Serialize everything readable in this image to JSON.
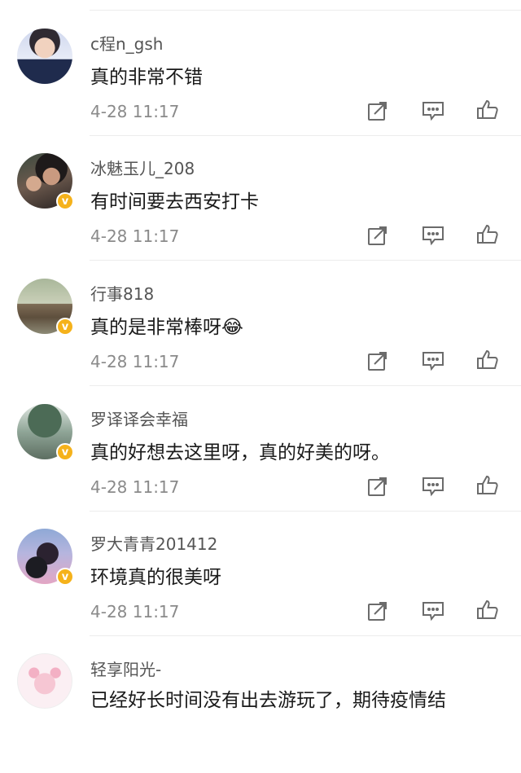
{
  "comments": [
    {
      "username": "c程n_gsh",
      "text": "真的非常不错",
      "time": "4-28 11:17",
      "verified": false
    },
    {
      "username": "冰魅玉儿_208",
      "text": "有时间要去西安打卡",
      "time": "4-28 11:17",
      "verified": true
    },
    {
      "username": "行事818",
      "text": "真的是非常棒呀",
      "emoji": "😂",
      "time": "4-28 11:17",
      "verified": true
    },
    {
      "username": "罗译译会幸福",
      "text": "真的好想去这里呀，真的好美的呀。",
      "time": "4-28 11:17",
      "verified": true
    },
    {
      "username": "罗大青青201412",
      "text": "环境真的很美呀",
      "time": "4-28 11:17",
      "verified": true
    },
    {
      "username": "轻享阳光-",
      "text": "已经好长时间没有出去游玩了，期待疫情结",
      "verified": false
    }
  ],
  "badge_symbol": "v",
  "colors": {
    "badge": "#f5b21b",
    "icon": "#6b6b6b",
    "time": "#8a8a8a",
    "username": "#555555"
  },
  "icons": [
    "share-icon",
    "comment-icon",
    "like-icon"
  ]
}
